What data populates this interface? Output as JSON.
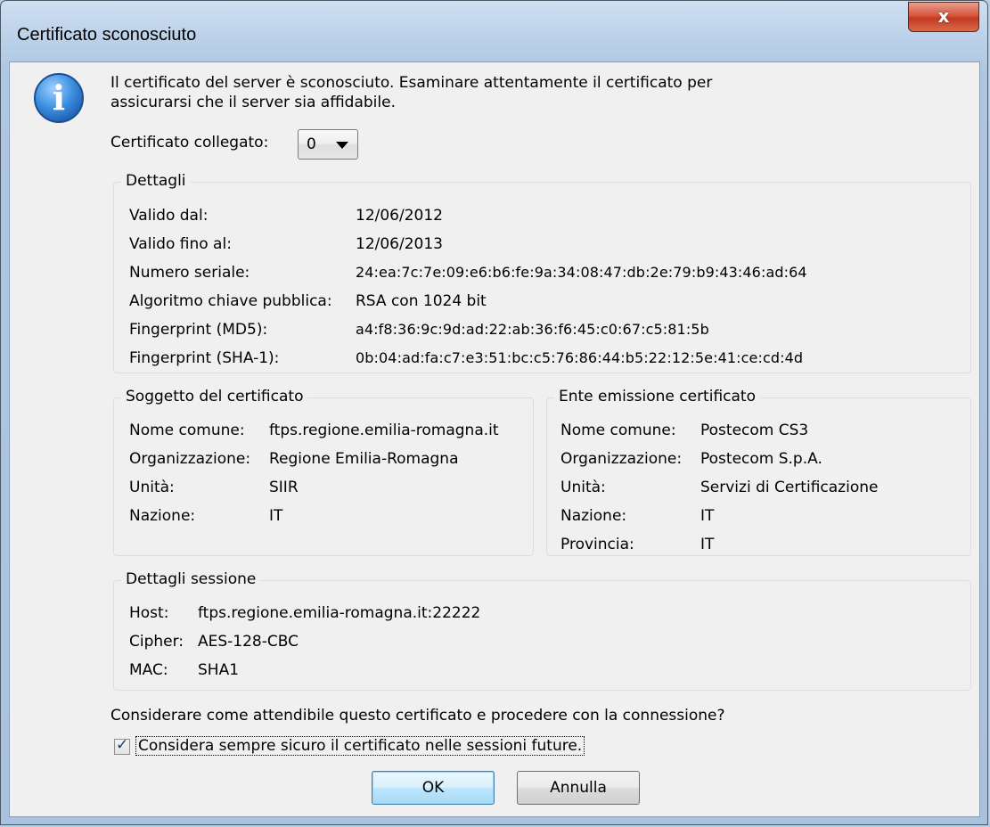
{
  "window": {
    "title": "Certificato sconosciuto",
    "close_glyph": "x"
  },
  "icons": {
    "info": "info-icon",
    "close": "close-icon",
    "dropdown": "chevron-down-icon"
  },
  "message": {
    "line1": "Il certificato del server è sconosciuto. Esaminare attentamente il certificato per",
    "line2": "assicurarsi che il server sia affidabile."
  },
  "linked_cert": {
    "label": "Certificato collegato:",
    "value": "0"
  },
  "details": {
    "title": "Dettagli",
    "rows": [
      {
        "label": "Valido dal:",
        "value": "12/06/2012"
      },
      {
        "label": "Valido fino al:",
        "value": "12/06/2013"
      },
      {
        "label": "Numero seriale:",
        "value": "24:ea:7c:7e:09:e6:b6:fe:9a:34:08:47:db:2e:79:b9:43:46:ad:64"
      },
      {
        "label": "Algoritmo chiave pubblica:",
        "value": "RSA con 1024 bit"
      },
      {
        "label": "Fingerprint (MD5):",
        "value": "a4:f8:36:9c:9d:ad:22:ab:36:f6:45:c0:67:c5:81:5b"
      },
      {
        "label": "Fingerprint (SHA-1):",
        "value": "0b:04:ad:fa:c7:e3:51:bc:c5:76:86:44:b5:22:12:5e:41:ce:cd:4d"
      }
    ]
  },
  "subject": {
    "title": "Soggetto del certificato",
    "rows": [
      {
        "label": "Nome comune:",
        "value": "ftps.regione.emilia-romagna.it"
      },
      {
        "label": "Organizzazione:",
        "value": "Regione Emilia-Romagna"
      },
      {
        "label": "Unità:",
        "value": "SIIR"
      },
      {
        "label": "Nazione:",
        "value": "IT"
      }
    ]
  },
  "issuer": {
    "title": "Ente emissione certificato",
    "rows": [
      {
        "label": "Nome comune:",
        "value": "Postecom CS3"
      },
      {
        "label": "Organizzazione:",
        "value": "Postecom S.p.A."
      },
      {
        "label": "Unità:",
        "value": "Servizi di Certificazione"
      },
      {
        "label": "Nazione:",
        "value": "IT"
      },
      {
        "label": "Provincia:",
        "value": "IT"
      }
    ]
  },
  "session": {
    "title": "Dettagli sessione",
    "rows": [
      {
        "label": "Host:",
        "value": "ftps.regione.emilia-romagna.it:22222"
      },
      {
        "label": "Cipher:",
        "value": "AES-128-CBC"
      },
      {
        "label": "MAC:",
        "value": "SHA1"
      }
    ]
  },
  "question": "Considerare come attendibile questo certificato e procedere con la connessione?",
  "always_trust": {
    "label": "Considera sempre sicuro il certificato nelle sessioni future.",
    "checked": true,
    "check_glyph": "✓"
  },
  "buttons": {
    "ok": "OK",
    "cancel": "Annulla"
  }
}
